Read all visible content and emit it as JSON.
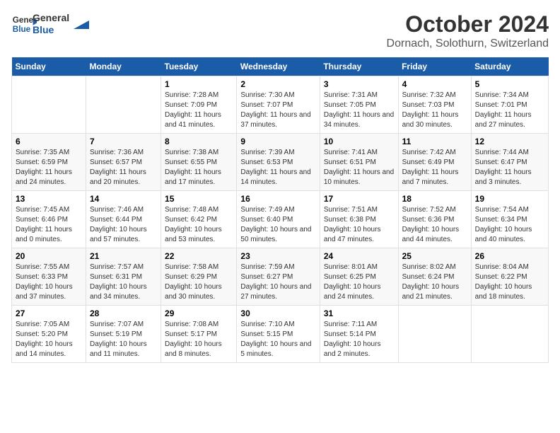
{
  "header": {
    "logo_line1": "General",
    "logo_line2": "Blue",
    "title": "October 2024",
    "subtitle": "Dornach, Solothurn, Switzerland"
  },
  "columns": [
    "Sunday",
    "Monday",
    "Tuesday",
    "Wednesday",
    "Thursday",
    "Friday",
    "Saturday"
  ],
  "weeks": [
    [
      {
        "day": "",
        "info": ""
      },
      {
        "day": "",
        "info": ""
      },
      {
        "day": "1",
        "info": "Sunrise: 7:28 AM\nSunset: 7:09 PM\nDaylight: 11 hours and 41 minutes."
      },
      {
        "day": "2",
        "info": "Sunrise: 7:30 AM\nSunset: 7:07 PM\nDaylight: 11 hours and 37 minutes."
      },
      {
        "day": "3",
        "info": "Sunrise: 7:31 AM\nSunset: 7:05 PM\nDaylight: 11 hours and 34 minutes."
      },
      {
        "day": "4",
        "info": "Sunrise: 7:32 AM\nSunset: 7:03 PM\nDaylight: 11 hours and 30 minutes."
      },
      {
        "day": "5",
        "info": "Sunrise: 7:34 AM\nSunset: 7:01 PM\nDaylight: 11 hours and 27 minutes."
      }
    ],
    [
      {
        "day": "6",
        "info": "Sunrise: 7:35 AM\nSunset: 6:59 PM\nDaylight: 11 hours and 24 minutes."
      },
      {
        "day": "7",
        "info": "Sunrise: 7:36 AM\nSunset: 6:57 PM\nDaylight: 11 hours and 20 minutes."
      },
      {
        "day": "8",
        "info": "Sunrise: 7:38 AM\nSunset: 6:55 PM\nDaylight: 11 hours and 17 minutes."
      },
      {
        "day": "9",
        "info": "Sunrise: 7:39 AM\nSunset: 6:53 PM\nDaylight: 11 hours and 14 minutes."
      },
      {
        "day": "10",
        "info": "Sunrise: 7:41 AM\nSunset: 6:51 PM\nDaylight: 11 hours and 10 minutes."
      },
      {
        "day": "11",
        "info": "Sunrise: 7:42 AM\nSunset: 6:49 PM\nDaylight: 11 hours and 7 minutes."
      },
      {
        "day": "12",
        "info": "Sunrise: 7:44 AM\nSunset: 6:47 PM\nDaylight: 11 hours and 3 minutes."
      }
    ],
    [
      {
        "day": "13",
        "info": "Sunrise: 7:45 AM\nSunset: 6:46 PM\nDaylight: 11 hours and 0 minutes."
      },
      {
        "day": "14",
        "info": "Sunrise: 7:46 AM\nSunset: 6:44 PM\nDaylight: 10 hours and 57 minutes."
      },
      {
        "day": "15",
        "info": "Sunrise: 7:48 AM\nSunset: 6:42 PM\nDaylight: 10 hours and 53 minutes."
      },
      {
        "day": "16",
        "info": "Sunrise: 7:49 AM\nSunset: 6:40 PM\nDaylight: 10 hours and 50 minutes."
      },
      {
        "day": "17",
        "info": "Sunrise: 7:51 AM\nSunset: 6:38 PM\nDaylight: 10 hours and 47 minutes."
      },
      {
        "day": "18",
        "info": "Sunrise: 7:52 AM\nSunset: 6:36 PM\nDaylight: 10 hours and 44 minutes."
      },
      {
        "day": "19",
        "info": "Sunrise: 7:54 AM\nSunset: 6:34 PM\nDaylight: 10 hours and 40 minutes."
      }
    ],
    [
      {
        "day": "20",
        "info": "Sunrise: 7:55 AM\nSunset: 6:33 PM\nDaylight: 10 hours and 37 minutes."
      },
      {
        "day": "21",
        "info": "Sunrise: 7:57 AM\nSunset: 6:31 PM\nDaylight: 10 hours and 34 minutes."
      },
      {
        "day": "22",
        "info": "Sunrise: 7:58 AM\nSunset: 6:29 PM\nDaylight: 10 hours and 30 minutes."
      },
      {
        "day": "23",
        "info": "Sunrise: 7:59 AM\nSunset: 6:27 PM\nDaylight: 10 hours and 27 minutes."
      },
      {
        "day": "24",
        "info": "Sunrise: 8:01 AM\nSunset: 6:25 PM\nDaylight: 10 hours and 24 minutes."
      },
      {
        "day": "25",
        "info": "Sunrise: 8:02 AM\nSunset: 6:24 PM\nDaylight: 10 hours and 21 minutes."
      },
      {
        "day": "26",
        "info": "Sunrise: 8:04 AM\nSunset: 6:22 PM\nDaylight: 10 hours and 18 minutes."
      }
    ],
    [
      {
        "day": "27",
        "info": "Sunrise: 7:05 AM\nSunset: 5:20 PM\nDaylight: 10 hours and 14 minutes."
      },
      {
        "day": "28",
        "info": "Sunrise: 7:07 AM\nSunset: 5:19 PM\nDaylight: 10 hours and 11 minutes."
      },
      {
        "day": "29",
        "info": "Sunrise: 7:08 AM\nSunset: 5:17 PM\nDaylight: 10 hours and 8 minutes."
      },
      {
        "day": "30",
        "info": "Sunrise: 7:10 AM\nSunset: 5:15 PM\nDaylight: 10 hours and 5 minutes."
      },
      {
        "day": "31",
        "info": "Sunrise: 7:11 AM\nSunset: 5:14 PM\nDaylight: 10 hours and 2 minutes."
      },
      {
        "day": "",
        "info": ""
      },
      {
        "day": "",
        "info": ""
      }
    ]
  ]
}
